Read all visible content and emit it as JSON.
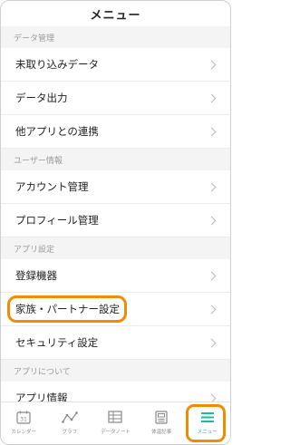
{
  "header": {
    "title": "メニュー"
  },
  "sections": [
    {
      "title": "データ管理",
      "items": [
        "未取り込みデータ",
        "データ出力",
        "他アプリとの連携"
      ]
    },
    {
      "title": "ユーザー情報",
      "items": [
        "アカウント管理",
        "プロフィール管理"
      ]
    },
    {
      "title": "アプリ設定",
      "items": [
        "登録機器",
        "家族・パートナー設定",
        "セキュリティ設定"
      ]
    },
    {
      "title": "アプリについて",
      "items": [
        "アプリ情報"
      ]
    }
  ],
  "tabs": [
    {
      "label": "カレンダー",
      "icon": "calendar-icon",
      "badge": "31"
    },
    {
      "label": "グラフ",
      "icon": "graph-icon"
    },
    {
      "label": "データノート",
      "icon": "data-note-icon"
    },
    {
      "label": "体温記事",
      "icon": "article-icon"
    },
    {
      "label": "メニュー",
      "icon": "menu-icon",
      "active": true
    }
  ],
  "colors": {
    "accent": "#1abc9c",
    "highlight": "#f08c00"
  }
}
